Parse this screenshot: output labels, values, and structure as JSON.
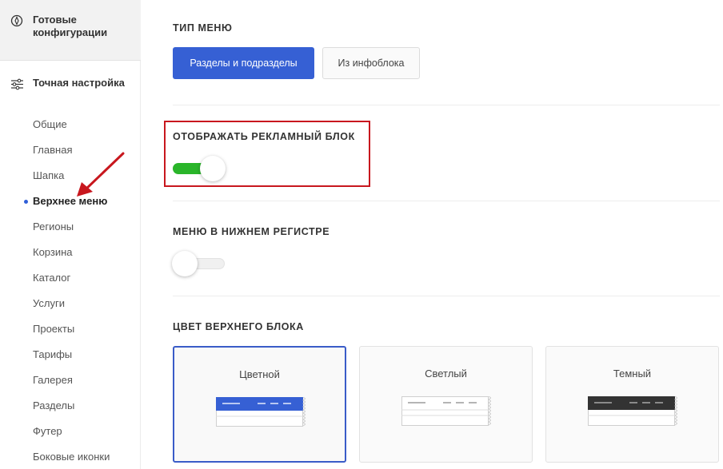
{
  "sidebar": {
    "section1": {
      "title": "Готовые конфигурации",
      "icon": "compass-icon"
    },
    "section2": {
      "title": "Точная настройка",
      "icon": "sliders-icon"
    },
    "items": [
      {
        "label": "Общие"
      },
      {
        "label": "Главная"
      },
      {
        "label": "Шапка"
      },
      {
        "label": "Верхнее меню",
        "active": true
      },
      {
        "label": "Регионы"
      },
      {
        "label": "Корзина"
      },
      {
        "label": "Каталог"
      },
      {
        "label": "Услуги"
      },
      {
        "label": "Проекты"
      },
      {
        "label": "Тарифы"
      },
      {
        "label": "Галерея"
      },
      {
        "label": "Разделы"
      },
      {
        "label": "Футер"
      },
      {
        "label": "Боковые иконки"
      }
    ]
  },
  "main": {
    "menu_type": {
      "title": "ТИП МЕНЮ",
      "options": [
        "Разделы и подразделы",
        "Из инфоблока"
      ],
      "selected": "Разделы и подразделы"
    },
    "ad_block": {
      "title": "ОТОБРАЖАТЬ РЕКЛАМНЫЙ БЛОК",
      "enabled": true
    },
    "lowercase_menu": {
      "title": "МЕНЮ В НИЖНЕМ РЕГИСТРЕ",
      "enabled": false
    },
    "top_block_color": {
      "title": "ЦВЕТ ВЕРХНЕГО БЛОКА",
      "options": [
        "Цветной",
        "Светлый",
        "Темный"
      ],
      "selected": "Цветной"
    }
  },
  "colors": {
    "accent": "#3660d4",
    "toggle_on": "#2ab52a",
    "highlight": "#c8171e",
    "dark_preview": "#333333"
  }
}
